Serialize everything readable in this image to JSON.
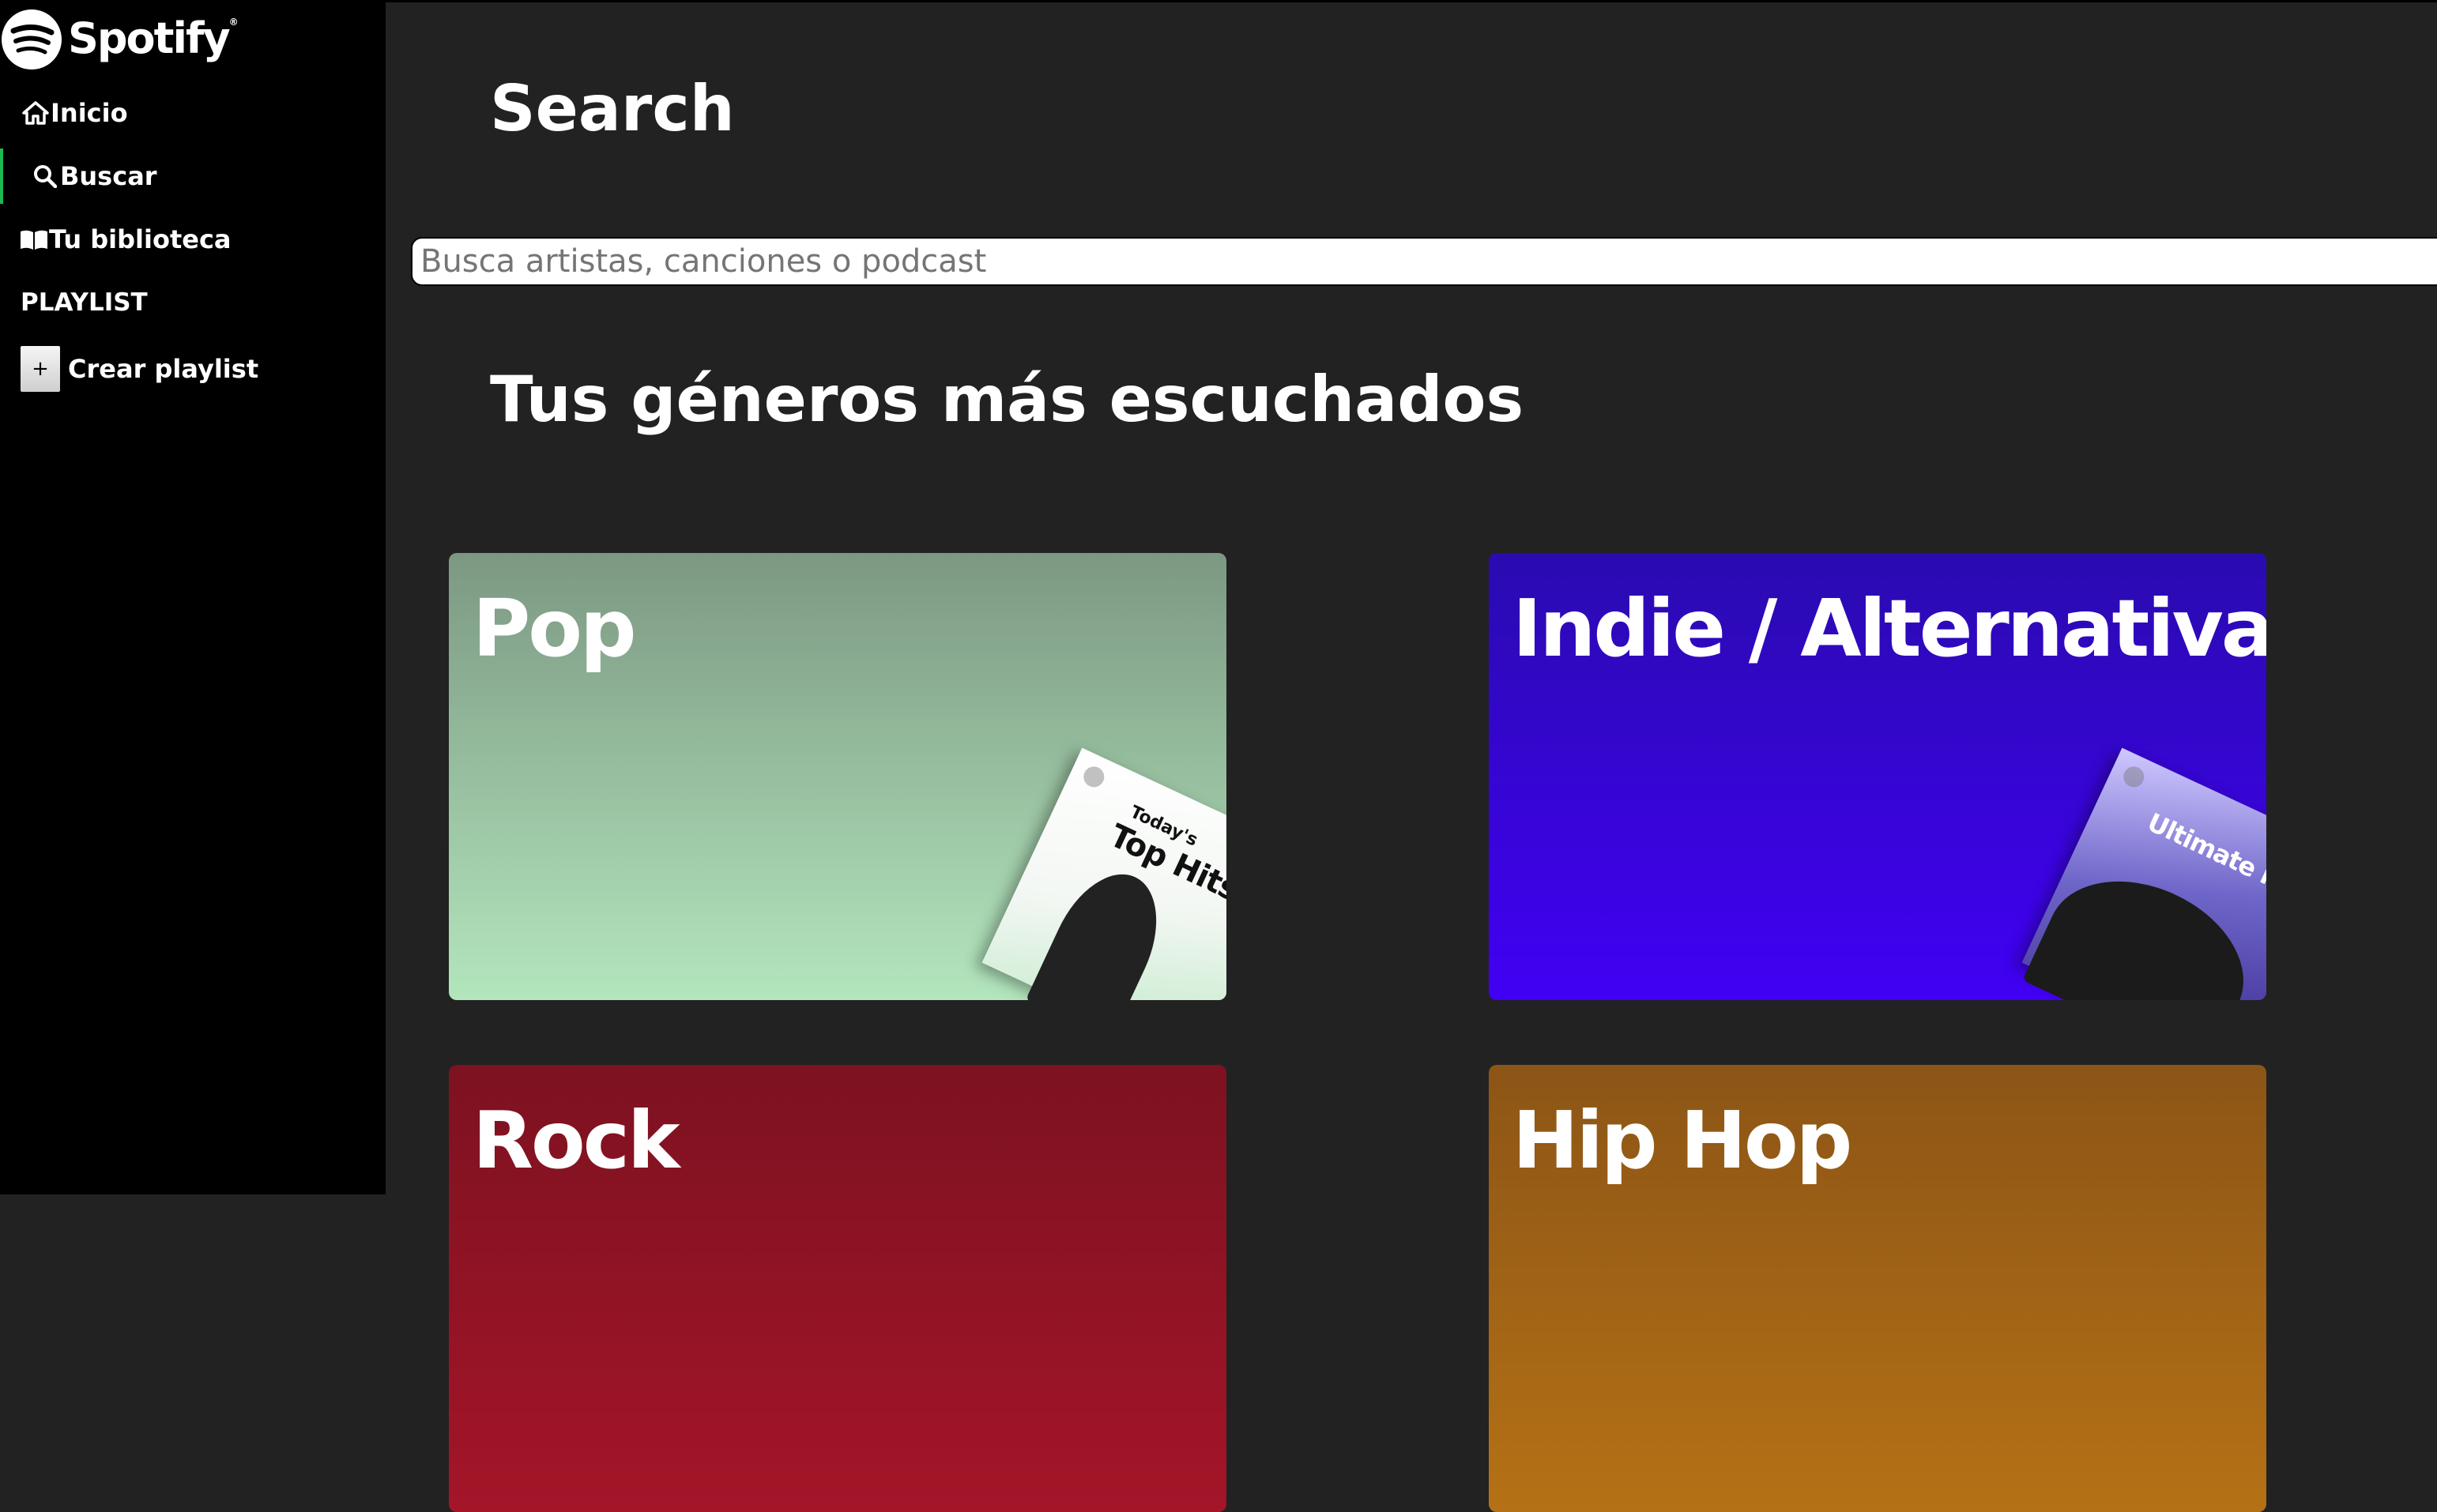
{
  "sidebar": {
    "logo_text": "Spotify",
    "nav": {
      "inicio": "Inicio",
      "buscar": "Buscar",
      "biblioteca": "Tu biblioteca"
    },
    "playlist_heading": "PLAYLIST",
    "create_playlist": {
      "plus_symbol": "+",
      "label": "Crear playlist"
    },
    "active_item": "buscar",
    "accent_color": "#1db954"
  },
  "main": {
    "page_title": "Search",
    "search": {
      "placeholder": "Busca artistas, canciones o podcast",
      "value": ""
    },
    "section_title": "Tus géneros más escuchados",
    "genres": [
      {
        "label": "Pop",
        "color": "#b3e6bd",
        "cover_small": "Today's",
        "cover_title": "Top Hits"
      },
      {
        "label": "Indie / Alternativa",
        "color": "#4100f4",
        "cover_title": "Ultimate Ind"
      },
      {
        "label": "Rock",
        "color": "#a41528"
      },
      {
        "label": "Hip Hop",
        "color": "#b57115"
      }
    ]
  },
  "colors": {
    "background": "#222222",
    "sidebar": "#000000",
    "text": "#ffffff"
  }
}
